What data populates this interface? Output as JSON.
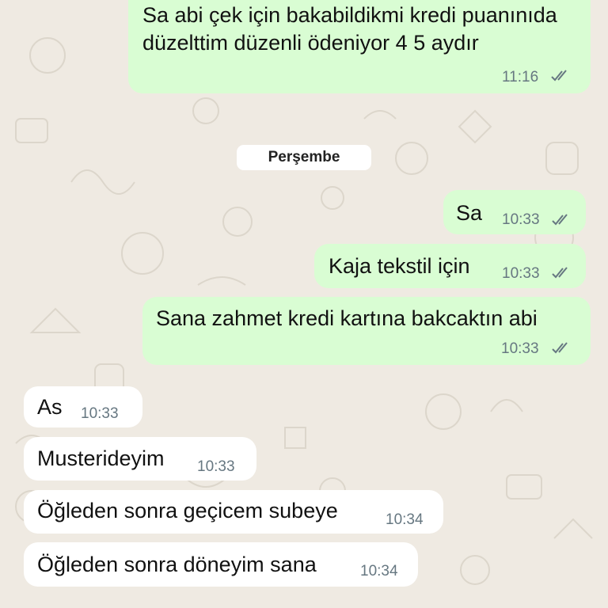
{
  "chat": {
    "date_separator": "Perşembe",
    "colors": {
      "background": "#efeae2",
      "outgoing_bubble": "#d9fdd3",
      "incoming_bubble": "#ffffff",
      "timestamp": "#667781",
      "read_ticks": "#667781"
    },
    "messages": [
      {
        "direction": "outgoing",
        "text": "Sa abi çek için bakabildikmi kredi puanınıda düzelttim düzenli ödeniyor 4 5 aydır",
        "time": "11:16",
        "status": "delivered-double-check-icon"
      },
      {
        "direction": "outgoing",
        "text": "Sa",
        "time": "10:33",
        "status": "delivered-double-check-icon"
      },
      {
        "direction": "outgoing",
        "text": "Kaja tekstil için",
        "time": "10:33",
        "status": "delivered-double-check-icon"
      },
      {
        "direction": "outgoing",
        "text": "Sana zahmet kredi kartına bakcaktın abi",
        "time": "10:33",
        "status": "delivered-double-check-icon"
      },
      {
        "direction": "incoming",
        "text": "As",
        "time": "10:33"
      },
      {
        "direction": "incoming",
        "text": "Musterideyim",
        "time": "10:33"
      },
      {
        "direction": "incoming",
        "text": "Öğleden sonra geçicem subeye",
        "time": "10:34"
      },
      {
        "direction": "incoming",
        "text": "Öğleden sonra döneyim sana",
        "time": "10:34"
      }
    ]
  }
}
